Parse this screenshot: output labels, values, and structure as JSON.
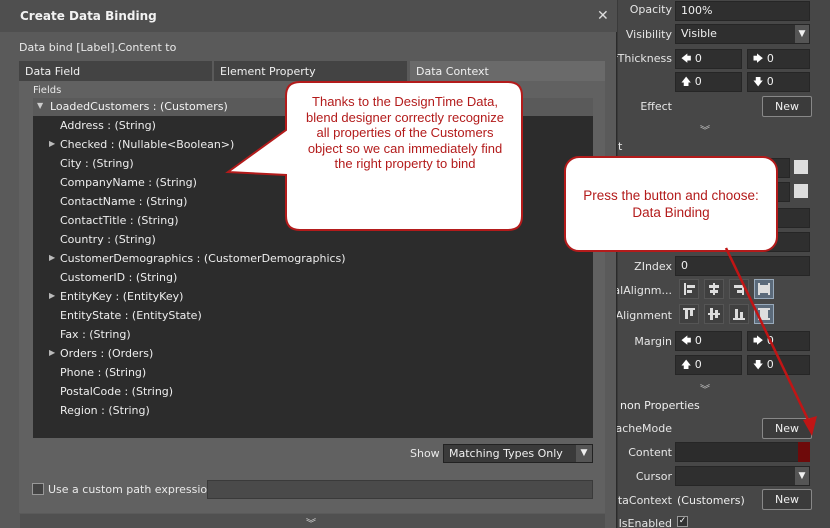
{
  "dialog": {
    "title": "Create Data Binding",
    "subtitle": "Data bind [Label].Content to",
    "tabs": [
      "Data Field",
      "Element Property",
      "Data Context"
    ],
    "fields_label": "Fields",
    "tree": {
      "root": "LoadedCustomers : (Customers)",
      "items": [
        {
          "label": "Address : (String)",
          "expandable": false
        },
        {
          "label": "Checked : (Nullable<Boolean>)",
          "expandable": true
        },
        {
          "label": "City : (String)",
          "expandable": false
        },
        {
          "label": "CompanyName : (String)",
          "expandable": false
        },
        {
          "label": "ContactName : (String)",
          "expandable": false
        },
        {
          "label": "ContactTitle : (String)",
          "expandable": false
        },
        {
          "label": "Country : (String)",
          "expandable": false
        },
        {
          "label": "CustomerDemographics : (CustomerDemographics)",
          "expandable": true
        },
        {
          "label": "CustomerID : (String)",
          "expandable": false
        },
        {
          "label": "EntityKey : (EntityKey)",
          "expandable": true
        },
        {
          "label": "EntityState : (EntityState)",
          "expandable": false
        },
        {
          "label": "Fax : (String)",
          "expandable": false
        },
        {
          "label": "Orders : (Orders)",
          "expandable": true
        },
        {
          "label": "Phone : (String)",
          "expandable": false
        },
        {
          "label": "PostalCode : (String)",
          "expandable": false
        },
        {
          "label": "Region : (String)",
          "expandable": false
        }
      ]
    },
    "show_label": "Show",
    "show_value": "Matching Types Only",
    "custom_path_label": "Use a custom path expression"
  },
  "properties": {
    "opacity_label": "Opacity",
    "opacity_value": "100%",
    "visibility_label": "Visibility",
    "visibility_value": "Visible",
    "thickness_label": "rThickness",
    "thickness_values": [
      "0",
      "0",
      "0",
      "0"
    ],
    "effect_label": "Effect",
    "new_label": "New",
    "layout_cut_label": "t",
    "zindex_label": "ZIndex",
    "zindex_value": "0",
    "halign_label": "alAlignm...",
    "valign_label": "Alignment",
    "margin_label": "Margin",
    "margin_values": [
      "0",
      "0",
      "0",
      "0"
    ],
    "common_header": "non Properties",
    "cachemode_label": "acheMode",
    "content_label": "Content",
    "cursor_label": "Cursor",
    "datacontext_label": "taContext",
    "datacontext_value": "(Customers)",
    "isenabled_label": "IsEnabled"
  },
  "callouts": {
    "left": "Thanks to the DesignTime Data, blend designer correctly recognize all properties of the Customers object so we can immediately find the right property to bind",
    "right": "Press the button and choose: Data Binding",
    "color": "#b31b1b"
  }
}
